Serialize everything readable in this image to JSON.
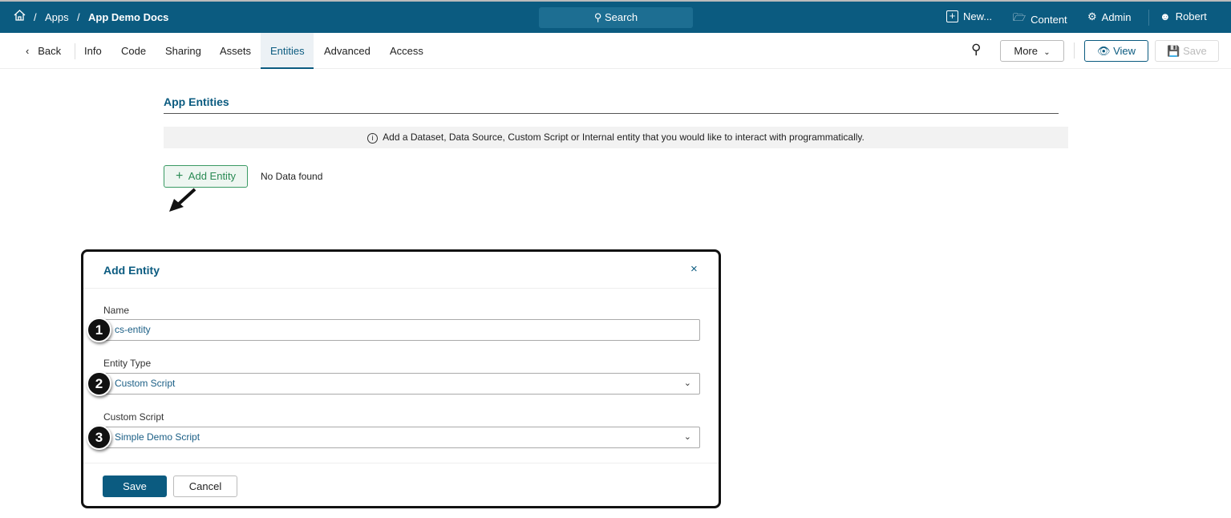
{
  "topbar": {
    "breadcrumb": [
      "Apps",
      "App Demo Docs"
    ],
    "search": "Search",
    "new": "New...",
    "content": "Content",
    "admin": "Admin",
    "user": "Robert"
  },
  "tabs": {
    "back": "Back",
    "items": [
      "Info",
      "Code",
      "Sharing",
      "Assets",
      "Entities",
      "Advanced",
      "Access"
    ],
    "more": "More",
    "view": "View",
    "save": "Save"
  },
  "main": {
    "title": "App Entities",
    "info": "Add a Dataset, Data Source, Custom Script or Internal entity that you would like to interact with programmatically.",
    "add_entity": "Add Entity",
    "empty": "No Data found"
  },
  "modal": {
    "title": "Add Entity",
    "name_label": "Name",
    "name_value": "cs-entity",
    "type_label": "Entity Type",
    "type_value": "Custom Script",
    "script_label": "Custom Script",
    "script_value": "Simple Demo Script",
    "save": "Save",
    "cancel": "Cancel",
    "callouts": [
      "1",
      "2",
      "3"
    ]
  }
}
